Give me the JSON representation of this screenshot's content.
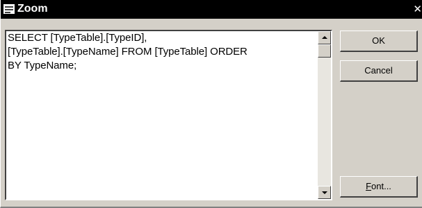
{
  "window": {
    "title": "Zoom",
    "close_glyph": "✕"
  },
  "editor": {
    "text": "SELECT [TypeTable].[TypeID],\n[TypeTable].[TypeName] FROM [TypeTable] ORDER\nBY TypeName;"
  },
  "buttons": {
    "ok_label": "OK",
    "cancel_label": "Cancel",
    "font_mnemonic": "F",
    "font_rest": "ont..."
  },
  "icons": {
    "window_icon": "form-icon",
    "scroll_up": "triangle-up-icon",
    "scroll_down": "triangle-down-icon"
  }
}
